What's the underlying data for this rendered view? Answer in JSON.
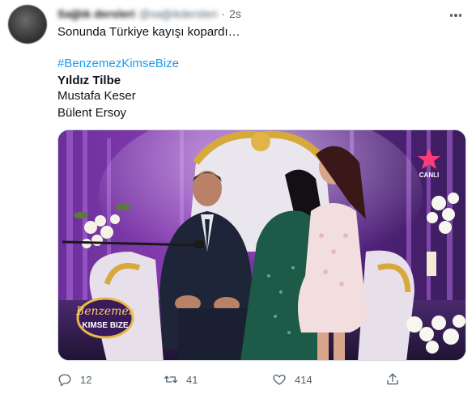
{
  "tweet": {
    "author_name": "Sağlık dersleri",
    "author_handle": "@sağlıkdersleri",
    "separator": "·",
    "time": "2s",
    "lines": {
      "text": "Sonunda Türkiye kayışı kopardı…",
      "hashtag": "#BenzemezKimseBize",
      "name1": "Yıldız Tilbe",
      "name2": "Mustafa Keser",
      "name3": "Bülent Ersoy"
    },
    "media": {
      "logo_line1": "Benzemez",
      "logo_line2": "KIMSE BIZE",
      "channel_label": "CANLI"
    },
    "actions": {
      "reply_count": "12",
      "retweet_count": "41",
      "like_count": "414"
    }
  },
  "colors": {
    "accent": "#1d9bf0",
    "secondary_text": "#536471",
    "text": "#0f1419"
  },
  "icons": [
    "more-icon",
    "reply-icon",
    "retweet-icon",
    "like-icon",
    "share-icon"
  ]
}
